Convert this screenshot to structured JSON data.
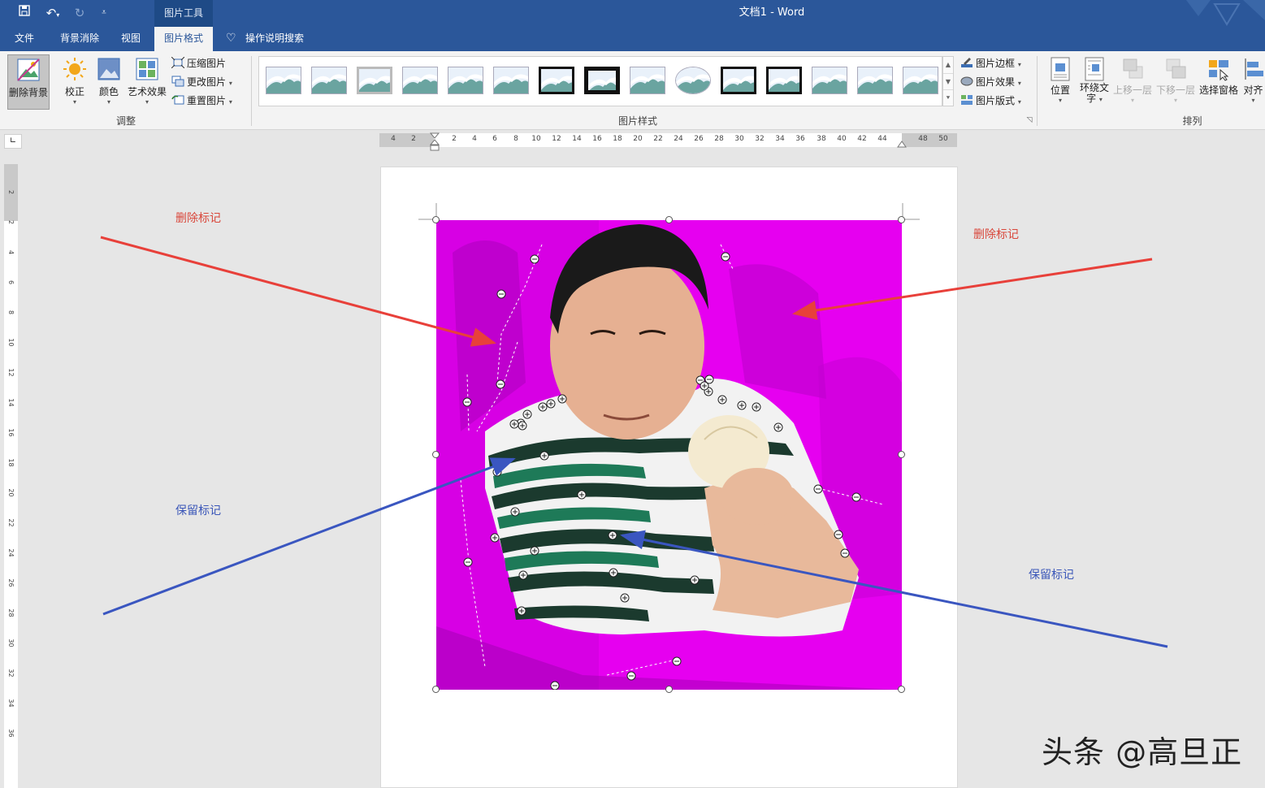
{
  "window": {
    "context_tab_group": "图片工具",
    "document_title": "文档1  -  Word",
    "qat": {
      "save_icon": "save-icon",
      "undo_icon": "undo-icon",
      "redo_icon": "redo-icon",
      "customize_icon": "customize-qat-icon"
    }
  },
  "tabs": [
    {
      "label": "文件"
    },
    {
      "label": "背景消除"
    },
    {
      "label": "视图"
    },
    {
      "label": "图片格式",
      "active": true
    }
  ],
  "tell_me": {
    "label": "操作说明搜索",
    "icon": "lightbulb-icon"
  },
  "ribbon": {
    "adjust": {
      "remove_background": "删除背景",
      "corrections": "校正",
      "color": "颜色",
      "artistic_effects": "艺术效果",
      "compress": "压缩图片",
      "change_picture": "更改图片",
      "reset_picture": "重置图片",
      "group_label": "调整"
    },
    "styles": {
      "group_label": "图片样式",
      "border": "图片边框",
      "effects": "图片效果",
      "layout": "图片版式",
      "thumb_count": 15
    },
    "arrange": {
      "position": "位置",
      "wrap_text_line1": "环绕文",
      "wrap_text_line2": "字",
      "bring_forward": "上移一层",
      "send_backward": "下移一层",
      "selection_pane": "选择窗格",
      "align": "对齐",
      "group_label": "排列"
    }
  },
  "ruler": {
    "horizontal": [
      "4",
      "2",
      "2",
      "4",
      "6",
      "8",
      "10",
      "12",
      "14",
      "16",
      "18",
      "20",
      "22",
      "24",
      "26",
      "28",
      "30",
      "32",
      "34",
      "36",
      "38",
      "40",
      "42",
      "44",
      "48",
      "50"
    ],
    "vertical": [
      "2",
      "2",
      "4",
      "6",
      "8",
      "10",
      "12",
      "14",
      "16",
      "18",
      "20",
      "22",
      "24",
      "26",
      "28",
      "30",
      "32",
      "34",
      "36"
    ]
  },
  "annotations": {
    "delete_mark_left": "删除标记",
    "delete_mark_right": "删除标记",
    "keep_mark_left": "保留标记",
    "keep_mark_right": "保留标记"
  },
  "colors": {
    "title_bar": "#2b579a",
    "removal_overlay": "#e600f0",
    "delete_arrow": "#e8403a",
    "keep_arrow": "#3a56c0"
  },
  "watermark": "头条 @高旦正"
}
